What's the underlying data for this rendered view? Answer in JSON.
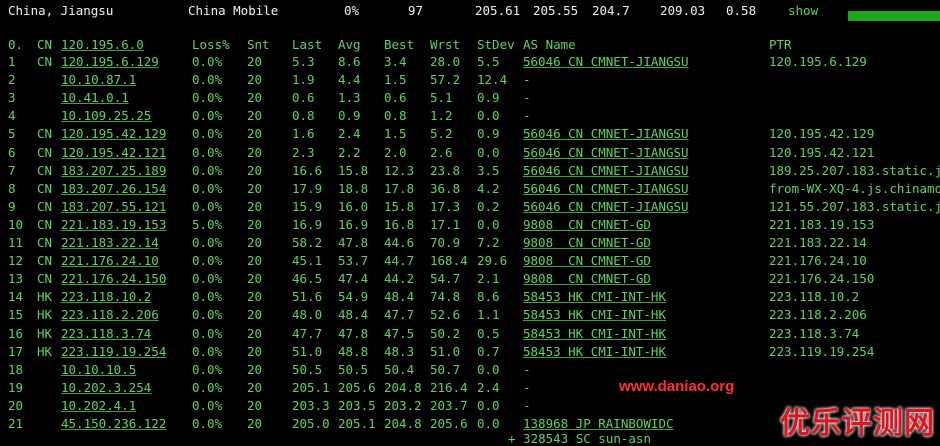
{
  "header": {
    "location": "China, Jiangsu",
    "isp": "China Mobile",
    "loss": "0%",
    "snt": "97",
    "last": "205.61",
    "avg": "205.55",
    "best": "204.7",
    "wrst": "209.03",
    "stdev": "0.58",
    "show_label": "show",
    "bar_color": "#1aa81a"
  },
  "columns": {
    "hop": "0.",
    "cc": "CN",
    "host": "120.195.6.0",
    "loss": "Loss%",
    "snt": "Snt",
    "last": "Last",
    "avg": "Avg",
    "best": "Best",
    "wrst": "Wrst",
    "stdev": "StDev",
    "as": "AS Name",
    "ptr": "PTR"
  },
  "rows": [
    {
      "hop": "1",
      "cc": "CN",
      "host": "120.195.6.129",
      "loss": "0.0%",
      "snt": "20",
      "last": "5.3",
      "avg": "8.6",
      "best": "3.4",
      "wrst": "28.0",
      "stdev": "5.5",
      "as": "56046 CN CMNET-JIANGSU",
      "ptr": "120.195.6.129"
    },
    {
      "hop": "2",
      "cc": "",
      "host": "10.10.87.1",
      "loss": "0.0%",
      "snt": "20",
      "last": "1.9",
      "avg": "4.4",
      "best": "1.5",
      "wrst": "57.2",
      "stdev": "12.4",
      "as": "-",
      "ptr": ""
    },
    {
      "hop": "3",
      "cc": "",
      "host": "10.41.0.1",
      "loss": "0.0%",
      "snt": "20",
      "last": "0.6",
      "avg": "1.3",
      "best": "0.6",
      "wrst": "5.1",
      "stdev": "0.9",
      "as": "-",
      "ptr": ""
    },
    {
      "hop": "4",
      "cc": "",
      "host": "10.109.25.25",
      "loss": "0.0%",
      "snt": "20",
      "last": "0.8",
      "avg": "0.9",
      "best": "0.8",
      "wrst": "1.2",
      "stdev": "0.0",
      "as": "-",
      "ptr": ""
    },
    {
      "hop": "5",
      "cc": "CN",
      "host": "120.195.42.129",
      "loss": "0.0%",
      "snt": "20",
      "last": "1.6",
      "avg": "2.4",
      "best": "1.5",
      "wrst": "5.2",
      "stdev": "0.9",
      "as": "56046 CN CMNET-JIANGSU",
      "ptr": "120.195.42.129"
    },
    {
      "hop": "6",
      "cc": "CN",
      "host": "120.195.42.121",
      "loss": "0.0%",
      "snt": "20",
      "last": "2.3",
      "avg": "2.2",
      "best": "2.0",
      "wrst": "2.6",
      "stdev": "0.0",
      "as": "56046 CN CMNET-JIANGSU",
      "ptr": "120.195.42.121"
    },
    {
      "hop": "7",
      "cc": "CN",
      "host": "183.207.25.189",
      "loss": "0.0%",
      "snt": "20",
      "last": "16.6",
      "avg": "15.8",
      "best": "12.3",
      "wrst": "23.8",
      "stdev": "3.5",
      "as": "56046 CN CMNET-JIANGSU",
      "ptr": "189.25.207.183.static.j"
    },
    {
      "hop": "8",
      "cc": "CN",
      "host": "183.207.26.154",
      "loss": "0.0%",
      "snt": "20",
      "last": "17.9",
      "avg": "18.8",
      "best": "17.8",
      "wrst": "36.8",
      "stdev": "4.2",
      "as": "56046 CN CMNET-JIANGSU",
      "ptr": "from-WX-XQ-4.js.chinamo"
    },
    {
      "hop": "9",
      "cc": "CN",
      "host": "183.207.55.121",
      "loss": "0.0%",
      "snt": "20",
      "last": "15.9",
      "avg": "16.0",
      "best": "15.8",
      "wrst": "17.3",
      "stdev": "0.2",
      "as": "56046 CN CMNET-JIANGSU",
      "ptr": "121.55.207.183.static.j"
    },
    {
      "hop": "10",
      "cc": "CN",
      "host": "221.183.19.153",
      "loss": "5.0%",
      "snt": "20",
      "last": "16.9",
      "avg": "16.9",
      "best": "16.8",
      "wrst": "17.1",
      "stdev": "0.0",
      "as": "9808  CN CMNET-GD",
      "ptr": "221.183.19.153"
    },
    {
      "hop": "11",
      "cc": "CN",
      "host": "221.183.22.14",
      "loss": "0.0%",
      "snt": "20",
      "last": "58.2",
      "avg": "47.8",
      "best": "44.6",
      "wrst": "70.9",
      "stdev": "7.2",
      "as": "9808  CN CMNET-GD",
      "ptr": "221.183.22.14"
    },
    {
      "hop": "12",
      "cc": "CN",
      "host": "221.176.24.10",
      "loss": "0.0%",
      "snt": "20",
      "last": "45.1",
      "avg": "53.7",
      "best": "44.7",
      "wrst": "168.4",
      "stdev": "29.6",
      "as": "9808  CN CMNET-GD",
      "ptr": "221.176.24.10"
    },
    {
      "hop": "13",
      "cc": "CN",
      "host": "221.176.24.150",
      "loss": "0.0%",
      "snt": "20",
      "last": "46.5",
      "avg": "47.4",
      "best": "44.2",
      "wrst": "54.7",
      "stdev": "2.1",
      "as": "9808  CN CMNET-GD",
      "ptr": "221.176.24.150"
    },
    {
      "hop": "14",
      "cc": "HK",
      "host": "223.118.10.2",
      "loss": "0.0%",
      "snt": "20",
      "last": "51.6",
      "avg": "54.9",
      "best": "48.4",
      "wrst": "74.8",
      "stdev": "8.6",
      "as": "58453 HK CMI-INT-HK",
      "ptr": "223.118.10.2"
    },
    {
      "hop": "15",
      "cc": "HK",
      "host": "223.118.2.206",
      "loss": "0.0%",
      "snt": "20",
      "last": "48.0",
      "avg": "48.4",
      "best": "47.7",
      "wrst": "52.6",
      "stdev": "1.1",
      "as": "58453 HK CMI-INT-HK",
      "ptr": "223.118.2.206"
    },
    {
      "hop": "16",
      "cc": "HK",
      "host": "223.118.3.74",
      "loss": "0.0%",
      "snt": "20",
      "last": "47.7",
      "avg": "47.8",
      "best": "47.5",
      "wrst": "50.2",
      "stdev": "0.5",
      "as": "58453 HK CMI-INT-HK",
      "ptr": "223.118.3.74"
    },
    {
      "hop": "17",
      "cc": "HK",
      "host": "223.119.19.254",
      "loss": "0.0%",
      "snt": "20",
      "last": "51.0",
      "avg": "48.8",
      "best": "48.3",
      "wrst": "51.0",
      "stdev": "0.7",
      "as": "58453 HK CMI-INT-HK",
      "ptr": "223.119.19.254"
    },
    {
      "hop": "18",
      "cc": "",
      "host": "10.10.10.5",
      "loss": "0.0%",
      "snt": "20",
      "last": "50.5",
      "avg": "50.5",
      "best": "50.4",
      "wrst": "50.7",
      "stdev": "0.0",
      "as": "-",
      "ptr": ""
    },
    {
      "hop": "19",
      "cc": "",
      "host": "10.202.3.254",
      "loss": "0.0%",
      "snt": "20",
      "last": "205.1",
      "avg": "205.6",
      "best": "204.8",
      "wrst": "216.4",
      "stdev": "2.4",
      "as": "-",
      "ptr": ""
    },
    {
      "hop": "20",
      "cc": "",
      "host": "10.202.4.1",
      "loss": "0.0%",
      "snt": "20",
      "last": "203.3",
      "avg": "203.5",
      "best": "203.2",
      "wrst": "203.7",
      "stdev": "0.0",
      "as": "-",
      "ptr": ""
    },
    {
      "hop": "21",
      "cc": "",
      "host": "45.150.236.122",
      "loss": "0.0%",
      "snt": "20",
      "last": "205.0",
      "avg": "205.1",
      "best": "204.8",
      "wrst": "205.6",
      "stdev": "0.0",
      "as": "138968 JP RAINBOWIDC",
      "ptr": ""
    }
  ],
  "footer": "+ 328543 SC sun-asn",
  "watermark": {
    "url": "www.daniao.org",
    "logo_text": "优乐评测网",
    "color": "#e0141e"
  }
}
